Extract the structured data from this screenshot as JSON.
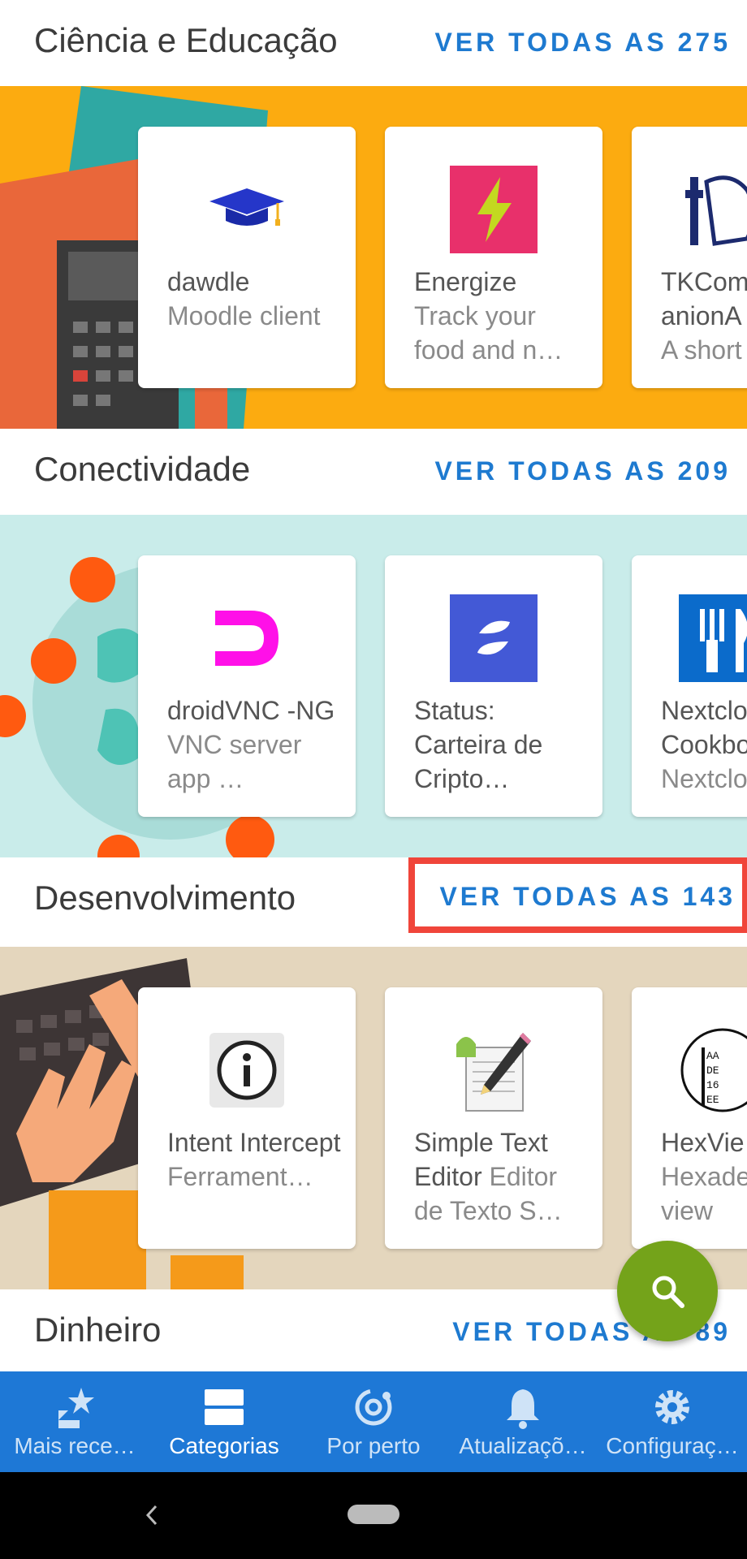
{
  "sections": [
    {
      "title": "Ciência e Educação",
      "see_all": "VER TODAS AS 275",
      "banner_color": "#fcab10",
      "apps": [
        {
          "name": "dawdle",
          "desc": "Moodle client",
          "icon": "graduation-cap-icon"
        },
        {
          "name": "Energize",
          "desc": "Track your food and n…",
          "icon": "lightning-icon"
        },
        {
          "name": "TKComp anionA",
          "desc": "A short",
          "icon": "brain-icon"
        }
      ]
    },
    {
      "title": "Conectividade",
      "see_all": "VER TODAS AS 209",
      "banner_color": "#c9ecea",
      "apps": [
        {
          "name": "droidVNC -NG",
          "desc": "VNC server app …",
          "icon": "vnc-icon"
        },
        {
          "name": "Status: Carteira de Cripto…",
          "desc": "",
          "icon": "status-icon"
        },
        {
          "name": "Nextclo Cookbo",
          "desc": "Nextclo",
          "icon": "fork-knife-icon"
        }
      ]
    },
    {
      "title": "Desenvolvimento",
      "see_all": "VER TODAS AS 143",
      "banner_color": "#e4d6bd",
      "apps": [
        {
          "name": "Intent Intercept",
          "desc": "Ferrament…",
          "icon": "info-icon"
        },
        {
          "name": "Simple Text Editor",
          "desc": "Editor de Texto S…",
          "icon": "text-editor-icon"
        },
        {
          "name": "HexVie",
          "desc": "Hexade al view",
          "icon": "hex-viewer-icon"
        }
      ]
    },
    {
      "title": "Dinheiro",
      "see_all": "VER TODAS AS 89"
    }
  ],
  "nav": [
    {
      "label": "Mais rece…",
      "icon": "star-arrow-icon"
    },
    {
      "label": "Categorias",
      "icon": "categories-icon"
    },
    {
      "label": "Por perto",
      "icon": "nearby-icon"
    },
    {
      "label": "Atualizaçõ…",
      "icon": "bell-icon"
    },
    {
      "label": "Configuraç…",
      "icon": "gear-icon"
    }
  ],
  "colors": {
    "accent": "#1e7ad0",
    "nav_bg": "#1e78d6",
    "fab": "#74a31a",
    "highlight": "#f0453a"
  }
}
